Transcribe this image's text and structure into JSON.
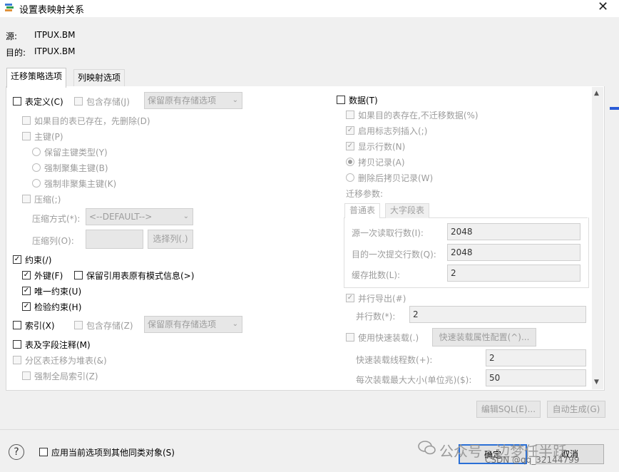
{
  "window": {
    "title": "设置表映射关系",
    "close_glyph": "✕"
  },
  "source": {
    "label": "源:",
    "value": "ITPUX.BM"
  },
  "target": {
    "label": "目的:",
    "value": "ITPUX.BM"
  },
  "tabs": [
    {
      "label": "迁移策略选项"
    },
    {
      "label": "列映射选项"
    }
  ],
  "left": {
    "table_def": {
      "label": "表定义(C)",
      "checked": false
    },
    "include_storage_1": {
      "label": "包含存储(J)"
    },
    "storage_combo_1": "保留原有存储选项",
    "drop_if_exists": {
      "label": "如果目的表已存在，先删除(D)"
    },
    "primary_key": {
      "label": "主键(P)"
    },
    "pk_options": [
      "保留主键类型(Y)",
      "强制聚集主键(B)",
      "强制非聚集主键(K)"
    ],
    "compress": {
      "label": "压缩(;)"
    },
    "compress_method_label": "压缩方式(*):",
    "compress_method_value": "<--DEFAULT-->",
    "compress_column_label": "压缩列(O):",
    "select_column_btn": "选择列(.)",
    "constraint": {
      "label": "约束(/)",
      "checked": true
    },
    "foreign_key": {
      "label": "外键(F)",
      "checked": true
    },
    "keep_ref": {
      "label": "保留引用表原有模式信息(>)",
      "checked": false
    },
    "unique": {
      "label": "唯一约束(U)",
      "checked": true
    },
    "check": {
      "label": "检验约束(H)",
      "checked": true
    },
    "index": {
      "label": "索引(X)",
      "checked": false
    },
    "include_storage_2": {
      "label": "包含存储(Z)"
    },
    "storage_combo_2": "保留原有存储选项",
    "comment": {
      "label": "表及字段注释(M)",
      "checked": false
    },
    "partition_heap": {
      "label": "分区表迁移为堆表(&)"
    },
    "global_index": {
      "label": "强制全局索引(Z)"
    }
  },
  "right": {
    "data": {
      "label": "数据(T)",
      "checked": false
    },
    "skip_if_exists": {
      "label": "如果目的表存在,不迁移数据(%)"
    },
    "identity_insert": {
      "label": "启用标志列插入(;)"
    },
    "show_rows": {
      "label": "显示行数(N)"
    },
    "copy_records": "拷贝记录(A)",
    "delete_then_copy": "删除后拷贝记录(W)",
    "migration_params_label": "迁移参数:",
    "subtabs": [
      "普通表",
      "大字段表"
    ],
    "src_read_label": "源一次读取行数(I):",
    "src_read_value": "2048",
    "dst_commit_label": "目的一次提交行数(Q):",
    "dst_commit_value": "2048",
    "cache_batch_label": "缓存批数(L):",
    "cache_batch_value": "2",
    "parallel_export": {
      "label": "并行导出(#)"
    },
    "parallel_count_label": "并行数(*):",
    "parallel_count_value": "2",
    "fast_load": {
      "label": "使用快速装载(.)"
    },
    "fast_load_config_btn": "快速装载属性配置(^)...",
    "fast_load_threads_label": "快速装载线程数(+):",
    "fast_load_threads_value": "2",
    "max_load_size_label": "每次装载最大大小(单位兆)($):",
    "max_load_size_value": "50"
  },
  "buttons": {
    "edit_sql": "编辑SQL(E)...",
    "auto_generate": "自动生成(G)",
    "ok": "确定",
    "cancel": "取消"
  },
  "footer": {
    "apply_label": "应用当前选项到其他同类对象(S)",
    "help_glyph": "?"
  },
  "watermark": {
    "line1": "公众号 · 边梦任半跃",
    "line2": "CSDN @qq_32144799"
  },
  "icons": {
    "app": "migration-app-icon",
    "check": "✓",
    "scroll_up": "▲",
    "scroll_down": "▼",
    "combo_arrow": "⌄",
    "wechat": "wechat-icon"
  }
}
